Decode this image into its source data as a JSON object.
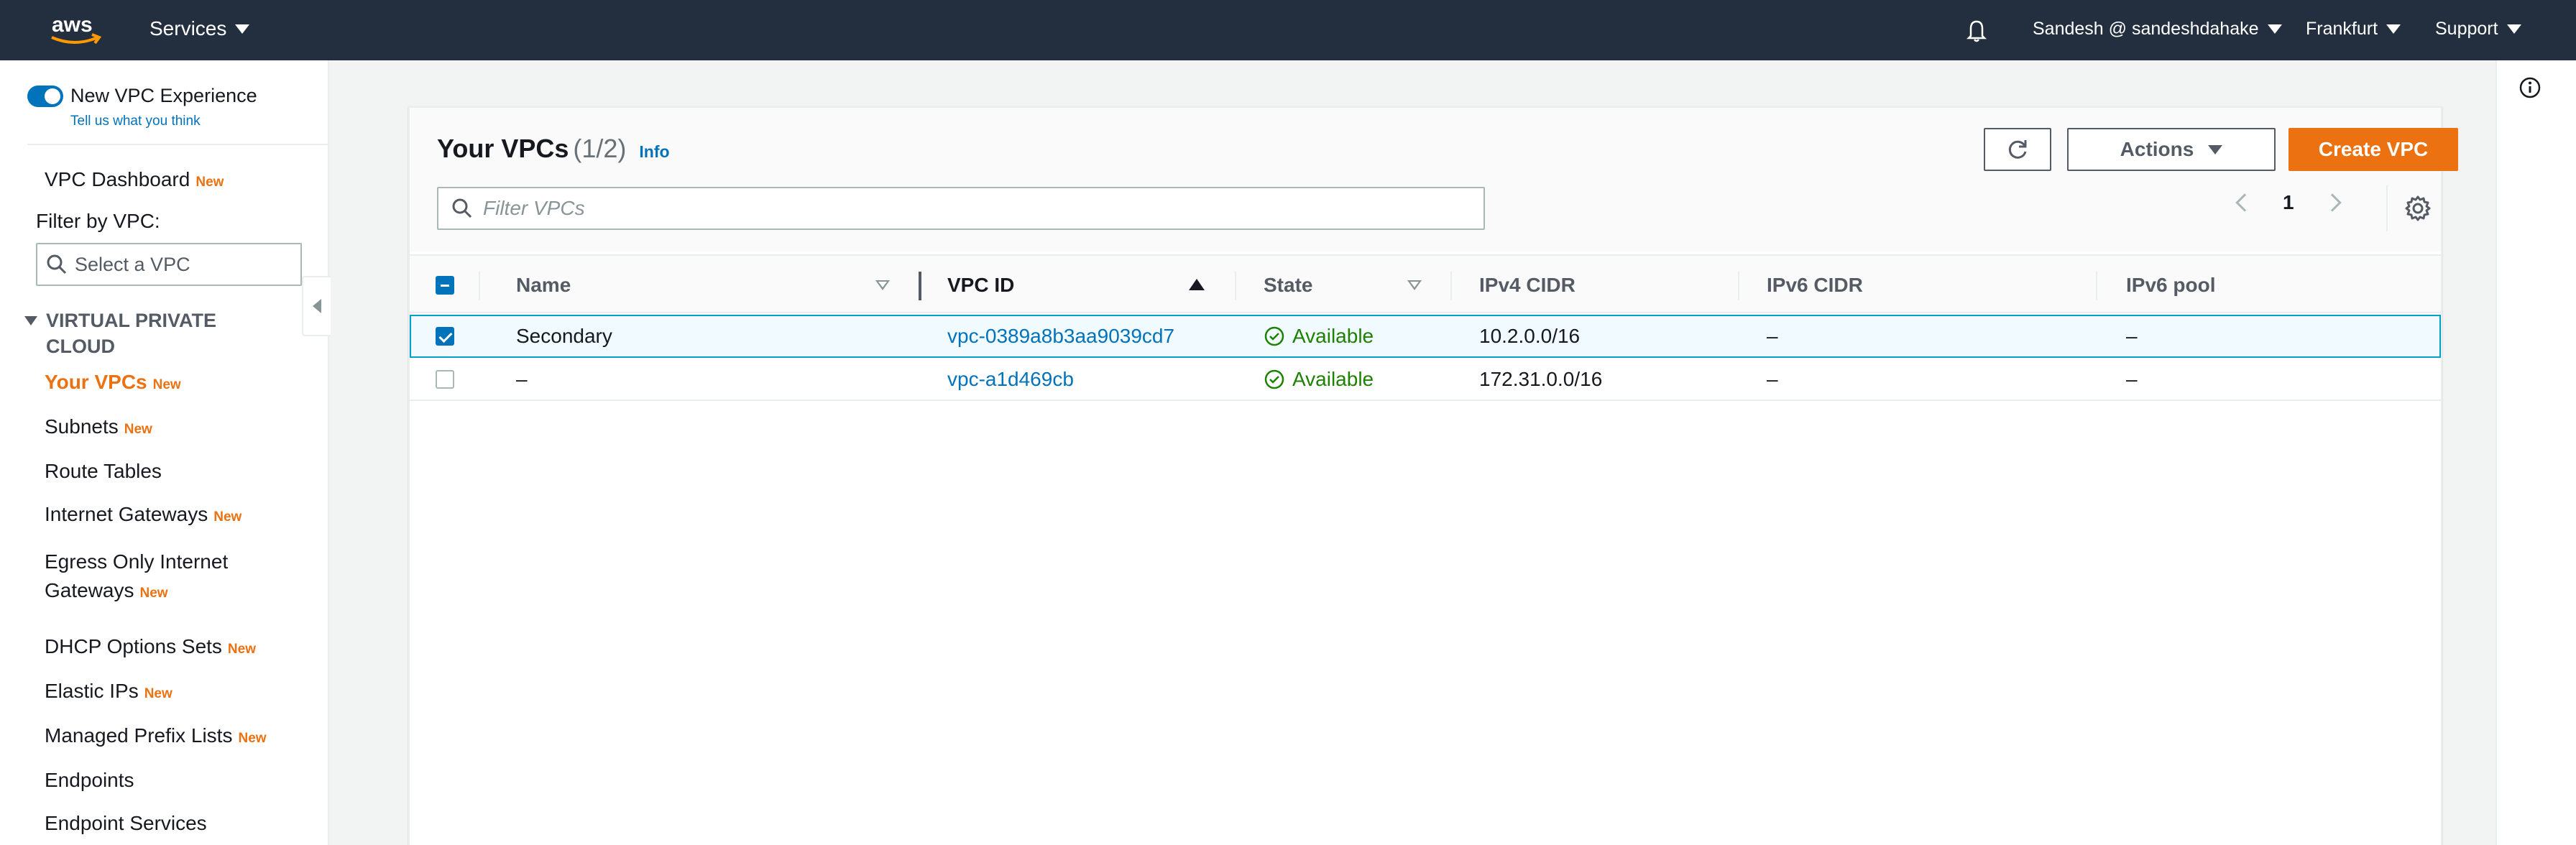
{
  "topnav": {
    "logo_text": "aws",
    "services_label": "Services",
    "user_label": "Sandesh @ sandeshdahake",
    "region_label": "Frankfurt",
    "support_label": "Support"
  },
  "sidebar": {
    "toggle_label": "New VPC Experience",
    "toggle_sublink": "Tell us what you think",
    "dashboard_label": "VPC Dashboard",
    "new_badge": "New",
    "filter_label": "Filter by VPC:",
    "filter_placeholder": "Select a VPC",
    "section_title": "VIRTUAL PRIVATE CLOUD",
    "items": [
      {
        "label": "Your VPCs",
        "new": true,
        "active": true
      },
      {
        "label": "Subnets",
        "new": true
      },
      {
        "label": "Route Tables",
        "new": false
      },
      {
        "label": "Internet Gateways",
        "new": true
      },
      {
        "label": "Egress Only Internet Gateways",
        "new": true
      },
      {
        "label": "DHCP Options Sets",
        "new": true
      },
      {
        "label": "Elastic IPs",
        "new": true
      },
      {
        "label": "Managed Prefix Lists",
        "new": true
      },
      {
        "label": "Endpoints",
        "new": false
      },
      {
        "label": "Endpoint Services",
        "new": false
      }
    ]
  },
  "panel": {
    "title": "Your VPCs",
    "count": "(1/2)",
    "info_label": "Info",
    "actions_label": "Actions",
    "create_label": "Create VPC",
    "search_placeholder": "Filter VPCs",
    "page_number": "1"
  },
  "table": {
    "columns": [
      "Name",
      "VPC ID",
      "State",
      "IPv4 CIDR",
      "IPv6 CIDR",
      "IPv6 pool"
    ],
    "rows": [
      {
        "selected": true,
        "name": "Secondary",
        "vpc_id": "vpc-0389a8b3aa9039cd7",
        "state": "Available",
        "ipv4": "10.2.0.0/16",
        "ipv6": "–",
        "pool": "–"
      },
      {
        "selected": false,
        "name": "–",
        "vpc_id": "vpc-a1d469cb",
        "state": "Available",
        "ipv4": "172.31.0.0/16",
        "ipv6": "–",
        "pool": "–"
      }
    ]
  },
  "colors": {
    "nav_bg": "#232f3e",
    "accent_orange": "#ec7211",
    "link_blue": "#0073bb",
    "status_green": "#1d8102"
  },
  "icons": [
    "aws-logo",
    "bell-icon",
    "search-icon",
    "refresh-icon",
    "settings-gear-icon",
    "info-icon",
    "check-circle-icon"
  ]
}
